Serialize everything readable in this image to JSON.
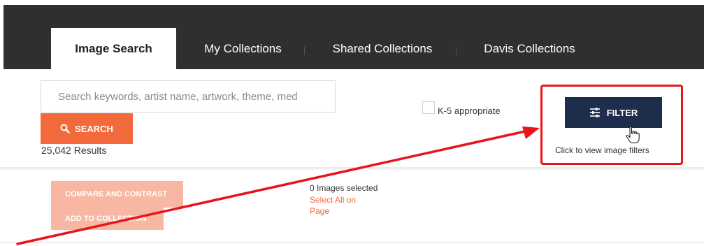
{
  "nav": {
    "tabs": [
      {
        "label": "Image Search",
        "active": true
      },
      {
        "label": "My Collections",
        "active": false
      },
      {
        "label": "Shared Collections",
        "active": false
      },
      {
        "label": "Davis Collections",
        "active": false
      }
    ]
  },
  "search": {
    "placeholder": "Search keywords, artist name, artwork, theme, med",
    "button_label": "SEARCH",
    "results_text": "25,042 Results"
  },
  "k5": {
    "label": "K-5 appropriate",
    "checked": false
  },
  "filter": {
    "button_label": "FILTER",
    "hint": "Click to view image filters"
  },
  "actions": {
    "compare_label": "COMPARE AND CONTRAST",
    "add_label": "ADD TO COLLECTION"
  },
  "selection": {
    "count_text": "0 Images selected",
    "select_all_text": "Select All on Page"
  },
  "colors": {
    "nav_bg": "#2f2f2f",
    "accent_orange": "#f26a3c",
    "filter_navy": "#1f2d4d",
    "annotation_red": "#e8141b"
  }
}
